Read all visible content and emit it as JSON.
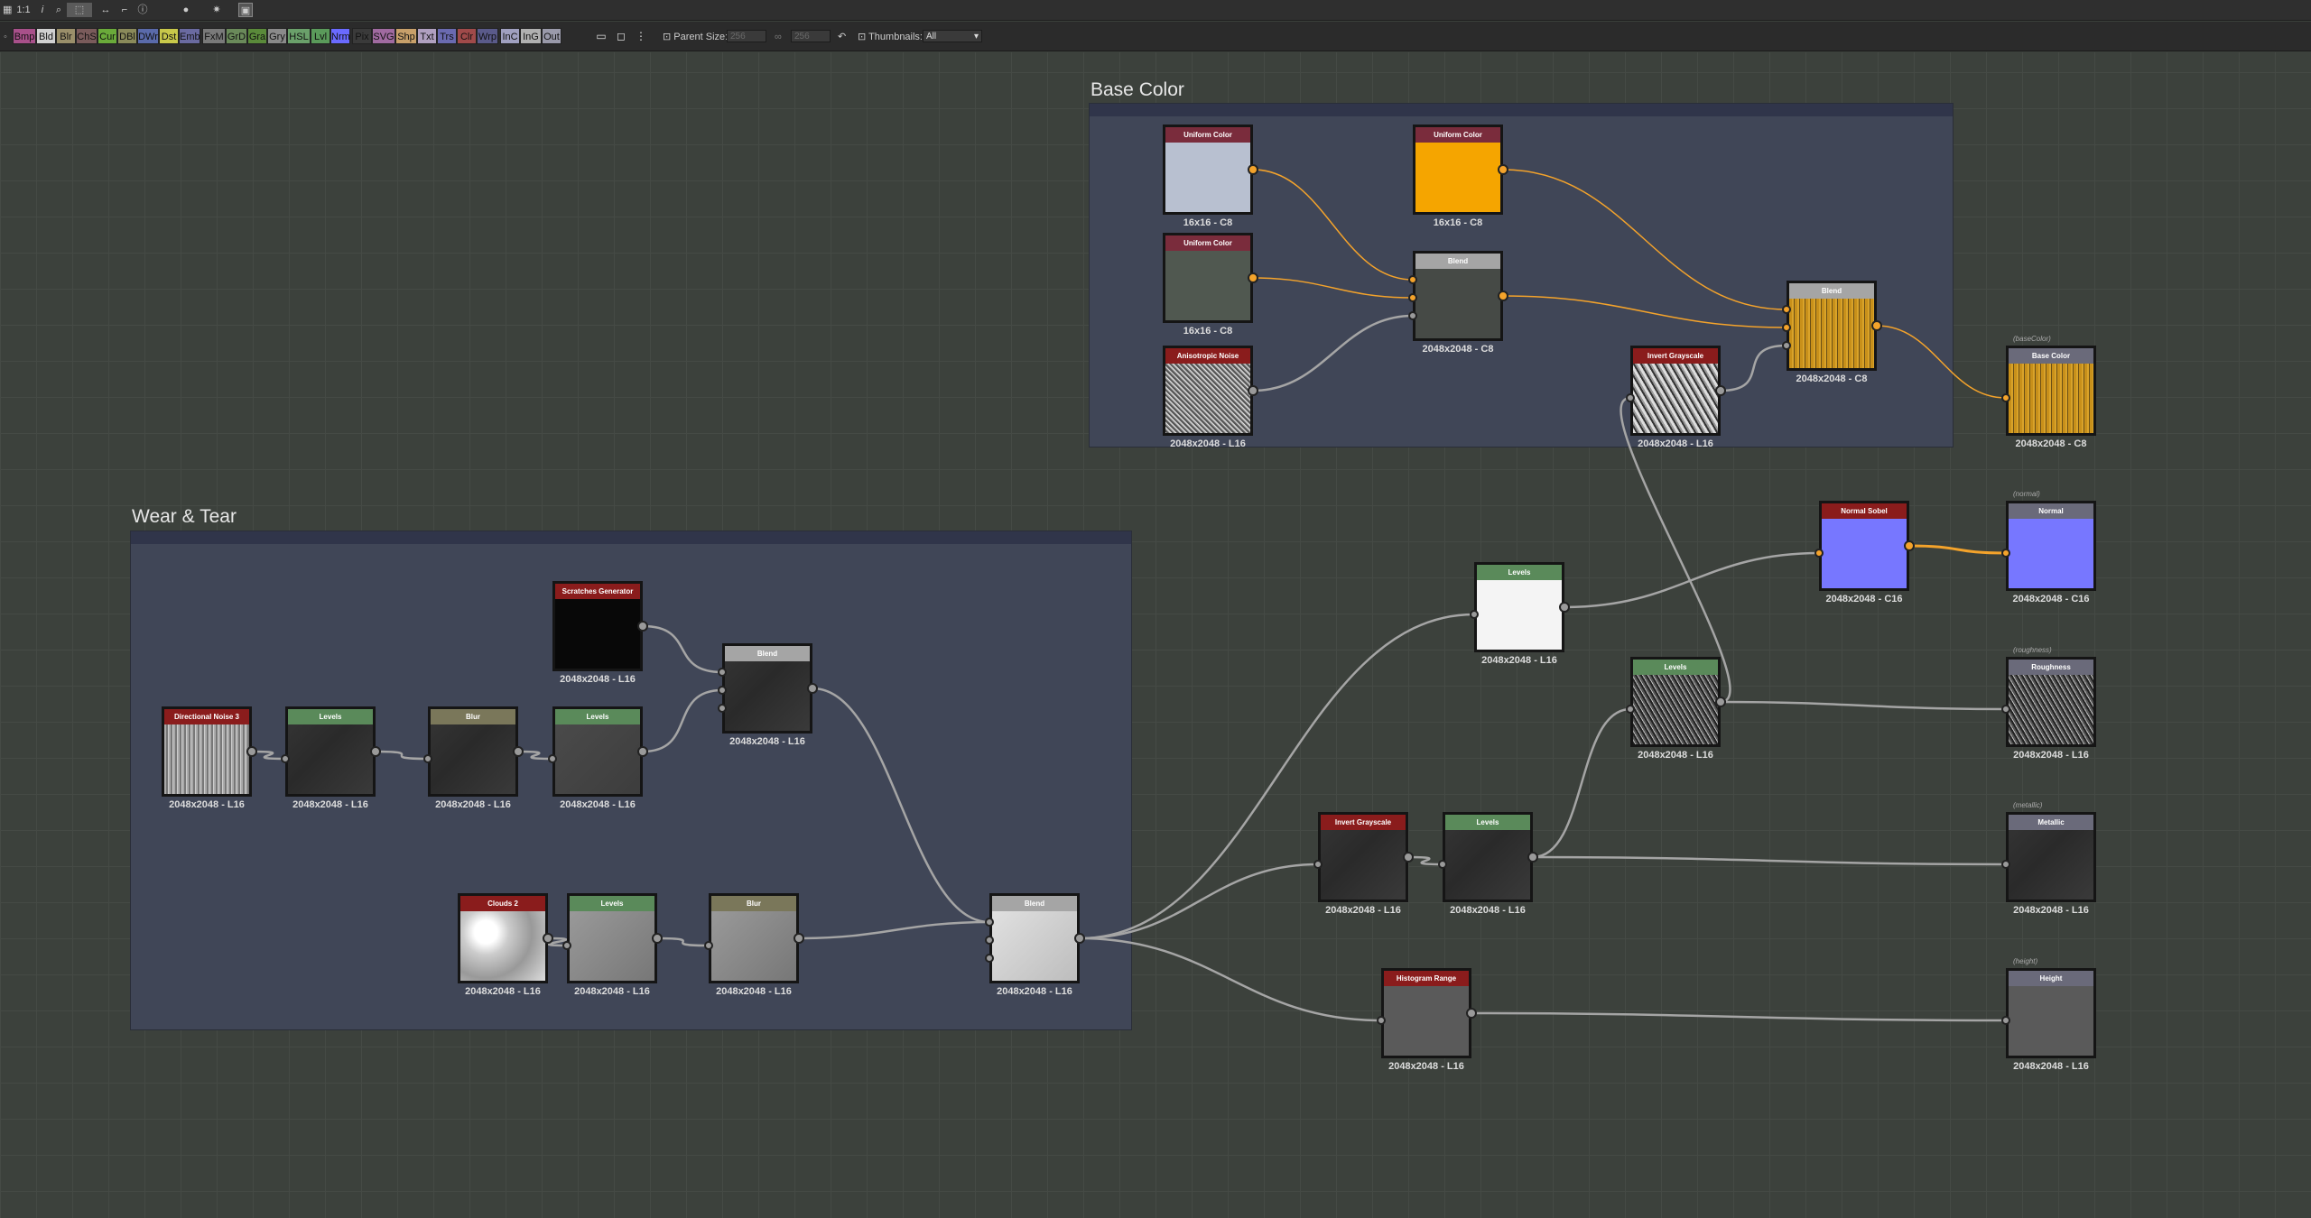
{
  "toolbar_top": {
    "zoom_label": "1:1",
    "items": [
      "info-icon",
      "zoom-icon",
      "select-icon",
      "move-icon",
      "frame-icon",
      "bulb-icon",
      "settings-icon",
      "window-icon"
    ]
  },
  "filter_buttons": [
    {
      "label": "Bmp",
      "color": "#a8508a"
    },
    {
      "label": "Bld",
      "color": "#d0d0d0"
    },
    {
      "label": "Blr",
      "color": "#9a8f6a"
    },
    {
      "label": "ChS",
      "color": "#7a5b5b"
    },
    {
      "label": "Cur",
      "color": "#6aaa3a"
    },
    {
      "label": "DBl",
      "color": "#8a8a5a"
    },
    {
      "label": "DWr",
      "color": "#5a6aaa"
    },
    {
      "label": "Dst",
      "color": "#c8c84a"
    },
    {
      "label": "Emb",
      "color": "#6a6aa0"
    },
    {
      "label": "FxM",
      "color": "#7a7a7a"
    },
    {
      "label": "GrD",
      "color": "#6a8a5a"
    },
    {
      "label": "Gra",
      "color": "#5a8a3a"
    },
    {
      "label": "Gry",
      "color": "#8a8a8a"
    },
    {
      "label": "HSL",
      "color": "#6aa06a"
    },
    {
      "label": "Lvl",
      "color": "#5a9a5a"
    },
    {
      "label": "Nrm",
      "color": "#6a6aff"
    },
    {
      "label": "Pix",
      "color": "#3a3a3a"
    },
    {
      "label": "SVG",
      "color": "#a06aa0"
    },
    {
      "label": "Shp",
      "color": "#c8a06a"
    },
    {
      "label": "Txt",
      "color": "#b0a0c0"
    },
    {
      "label": "Trs",
      "color": "#6a6ab0"
    },
    {
      "label": "Clr",
      "color": "#a04a4a"
    },
    {
      "label": "Wrp",
      "color": "#5a5a8a"
    },
    {
      "label": "InC",
      "color": "#a0a0c0"
    },
    {
      "label": "InG",
      "color": "#b0b0b0"
    },
    {
      "label": "Out",
      "color": "#9a9aaa"
    }
  ],
  "toolbar_right": {
    "parent_size_label": "Parent Size:",
    "parent_w": "256",
    "parent_h": "256",
    "thumbnails_label": "Thumbnails:",
    "thumbnails_value": "All"
  },
  "frames": [
    {
      "title": "Base Color"
    },
    {
      "title": "Wear & Tear"
    }
  ],
  "colors": {
    "canvas": "#3c413c",
    "frame": "#404657",
    "wire_orange": "#f4a32b",
    "wire_grey": "#a5a5a5"
  },
  "nodes": [
    {
      "title": "Uniform Color",
      "res": "16x16 - C8",
      "head": "#7a2c3c",
      "thumb": "#b8c0d0"
    },
    {
      "title": "Uniform Color",
      "res": "16x16 - C8",
      "head": "#7a2c3c",
      "thumb": "#f5a500"
    },
    {
      "title": "Uniform Color",
      "res": "16x16 - C8",
      "head": "#7a2c3c",
      "thumb": "#505850"
    },
    {
      "title": "Blend",
      "res": "2048x2048 - C8",
      "head": "#a5a5a5",
      "thumb": "#464a46"
    },
    {
      "title": "Anisotropic Noise",
      "res": "2048x2048 - L16",
      "head": "#8a1c1c",
      "thumb": "aniso"
    },
    {
      "title": "Invert Grayscale",
      "res": "2048x2048 - L16",
      "head": "#8a1c1c",
      "thumb": "stone"
    },
    {
      "title": "Blend",
      "res": "2048x2048 - C8",
      "head": "#a5a5a5",
      "thumb": "gold"
    },
    {
      "title": "Base Color",
      "res": "2048x2048 - C8",
      "id": "(baseColor)",
      "head": "#6a6a7a",
      "thumb": "gold"
    },
    {
      "title": "Normal Sobel",
      "res": "2048x2048 - C16",
      "head": "#8a1c1c",
      "thumb": "blue"
    },
    {
      "title": "Normal",
      "res": "2048x2048 - C16",
      "id": "(normal)",
      "head": "#6a6a7a",
      "thumb": "blue"
    },
    {
      "title": "Levels",
      "res": "2048x2048 - L16",
      "head": "#5a8a5a",
      "thumb": "white"
    },
    {
      "title": "Levels",
      "res": "2048x2048 - L16",
      "head": "#5a8a5a",
      "thumb": "rough"
    },
    {
      "title": "Roughness",
      "res": "2048x2048 - L16",
      "id": "(roughness)",
      "head": "#6a6a7a",
      "thumb": "rough"
    },
    {
      "title": "Invert Grayscale",
      "res": "2048x2048 - L16",
      "head": "#8a1c1c",
      "thumb": "dark"
    },
    {
      "title": "Levels",
      "res": "2048x2048 - L16",
      "head": "#5a8a5a",
      "thumb": "dark"
    },
    {
      "title": "Metallic",
      "res": "2048x2048 - L16",
      "id": "(metallic)",
      "head": "#6a6a7a",
      "thumb": "dark"
    },
    {
      "title": "Histogram Range",
      "res": "2048x2048 - L16",
      "head": "#8a1c1c",
      "thumb": "height"
    },
    {
      "title": "Height",
      "res": "2048x2048 - L16",
      "id": "(height)",
      "head": "#6a6a7a",
      "thumb": "height"
    },
    {
      "title": "Scratches Generator",
      "res": "2048x2048 - L16",
      "head": "#8a1c1c",
      "thumb": "scratch"
    },
    {
      "title": "Blend",
      "res": "2048x2048 - L16",
      "head": "#a5a5a5",
      "thumb": "dark"
    },
    {
      "title": "Directional Noise 3",
      "res": "2048x2048 - L16",
      "head": "#8a1c1c",
      "thumb": "noise"
    },
    {
      "title": "Levels",
      "res": "2048x2048 - L16",
      "head": "#5a8a5a",
      "thumb": "dark"
    },
    {
      "title": "Blur",
      "res": "2048x2048 - L16",
      "head": "#7a775a",
      "thumb": "dark"
    },
    {
      "title": "Levels",
      "res": "2048x2048 - L16",
      "head": "#5a8a5a",
      "thumb": "mid"
    },
    {
      "title": "Clouds 2",
      "res": "2048x2048 - L16",
      "head": "#8a1c1c",
      "thumb": "cloud"
    },
    {
      "title": "Levels",
      "res": "2048x2048 - L16",
      "head": "#5a8a5a",
      "thumb": "grey"
    },
    {
      "title": "Blur",
      "res": "2048x2048 - L16",
      "head": "#7a775a",
      "thumb": "grey"
    },
    {
      "title": "Blend",
      "res": "2048x2048 - L16",
      "head": "#a5a5a5",
      "thumb": "light"
    }
  ]
}
